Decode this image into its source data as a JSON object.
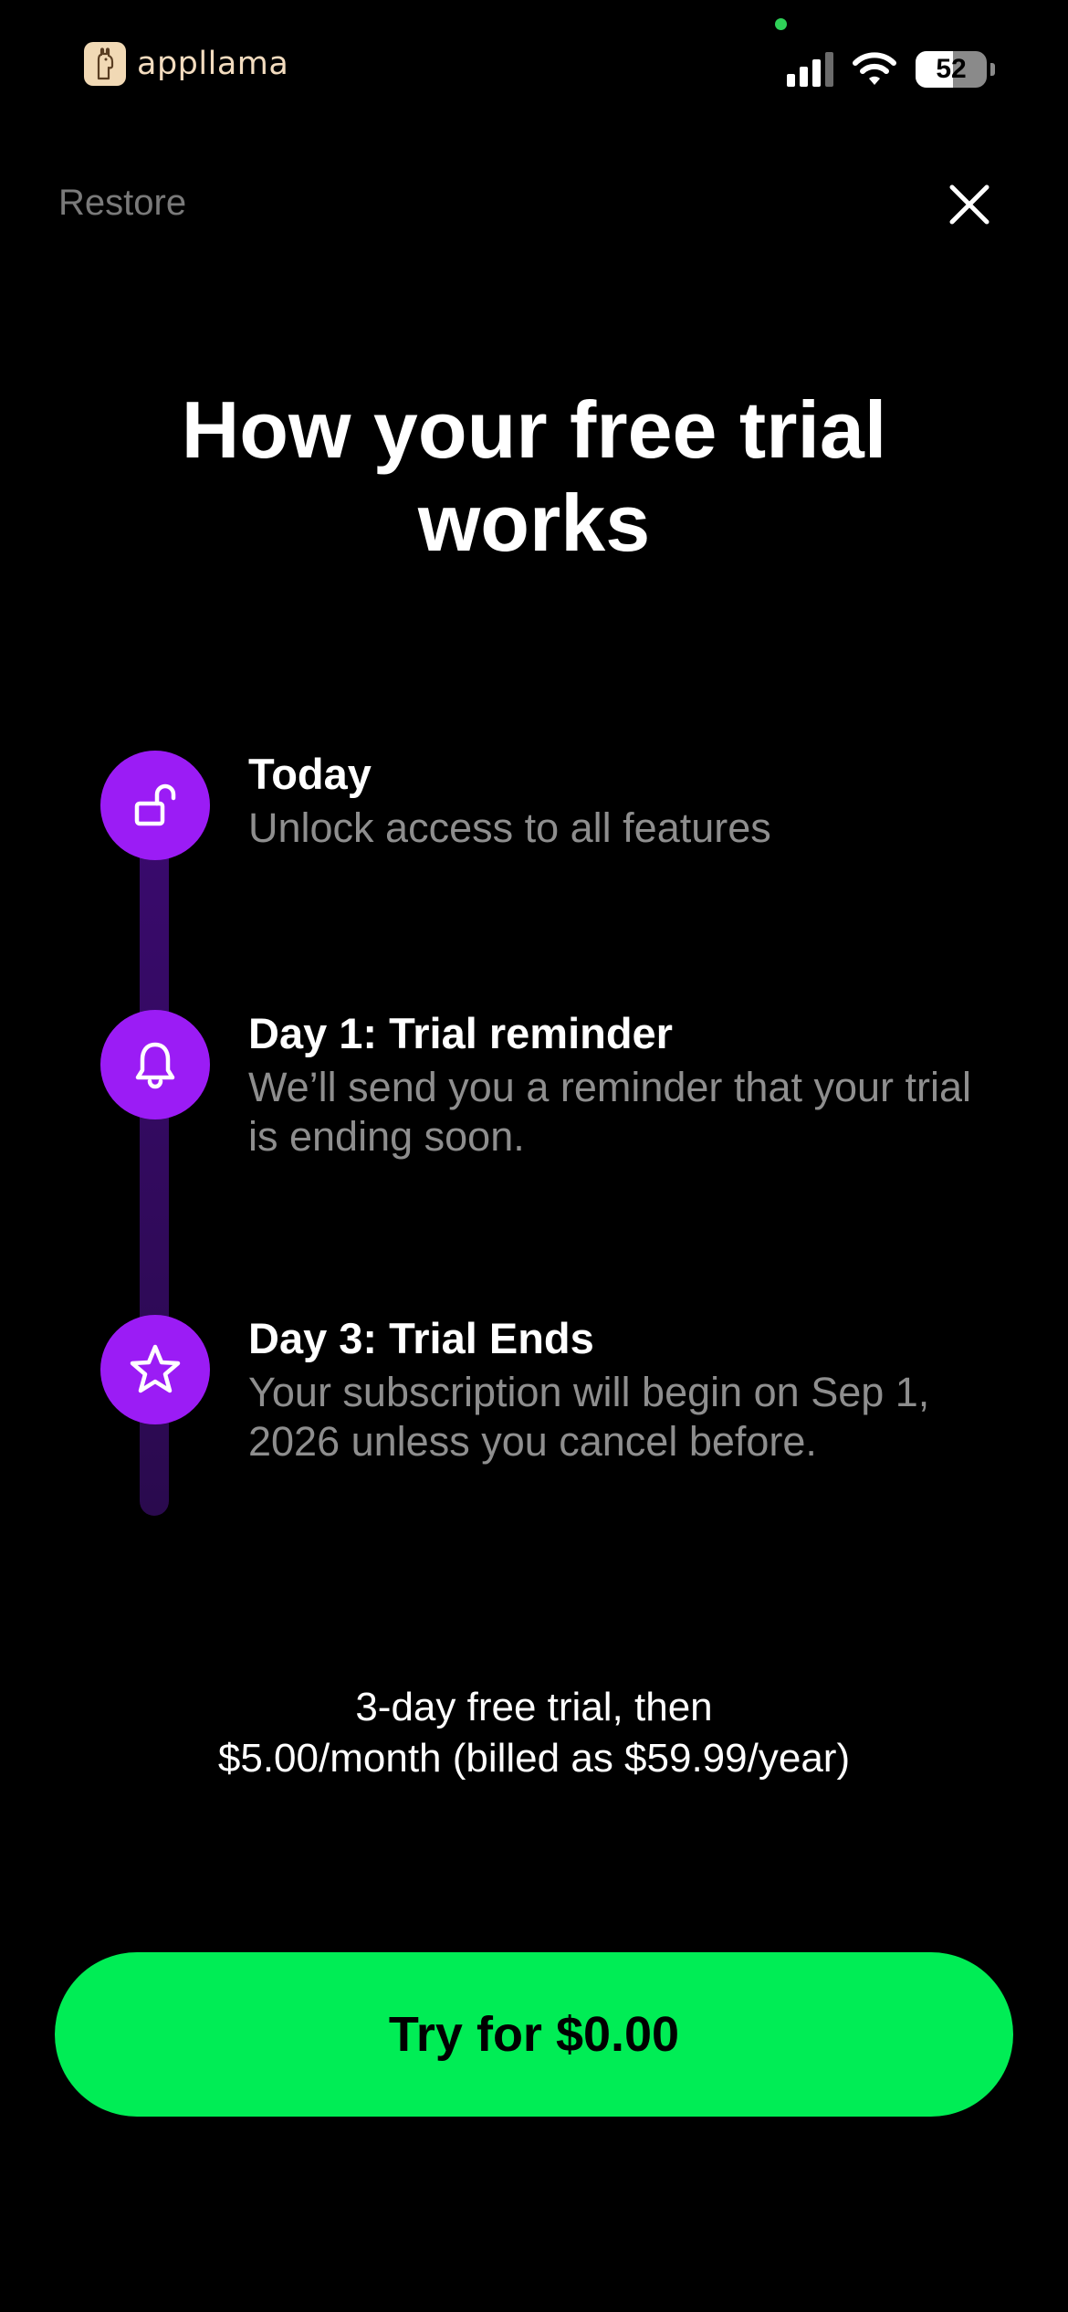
{
  "status_bar": {
    "brand_name": "appllama",
    "battery_percent": "52",
    "battery_level": 0.52
  },
  "header": {
    "restore_label": "Restore"
  },
  "title": "How your free trial works",
  "timeline": [
    {
      "icon": "unlock-icon",
      "title": "Today",
      "description": "Unlock access to all features"
    },
    {
      "icon": "bell-icon",
      "title": "Day 1: Trial reminder",
      "description": "We’ll send you a reminder that your trial is ending soon."
    },
    {
      "icon": "star-icon",
      "title": "Day 3: Trial Ends",
      "description": "Your subscription will begin on Sep 1, 2026 unless you cancel before."
    }
  ],
  "pricing": {
    "line1": "3-day free trial, then",
    "line2": "$5.00/month (billed as $59.99/year)"
  },
  "cta": {
    "label": "Try for $0.00"
  },
  "colors": {
    "accent_purple": "#9b1cf5",
    "cta_green": "#00ed55",
    "muted_text": "#8e8e8e",
    "background": "#000000"
  }
}
